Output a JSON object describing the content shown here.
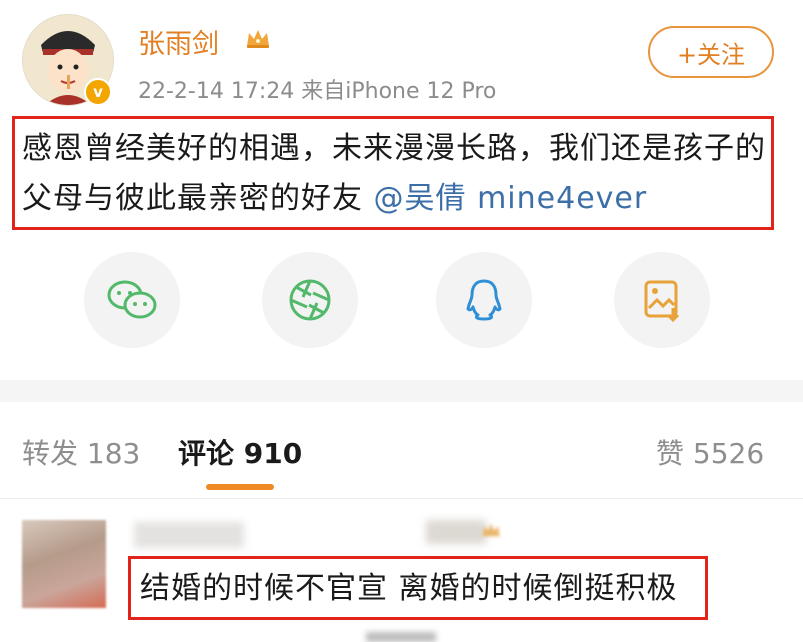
{
  "post": {
    "username": "张雨剑",
    "meta": "22-2-14 17:24 来自iPhone 12 Pro",
    "follow_label": "+关注",
    "verified_mark": "v",
    "text_main": "感恩曾经美好的相遇，未来漫漫长路，我们还是孩子的父母与彼此最亲密的好友",
    "mention": "@吴倩 mine4ever"
  },
  "share": {
    "icons": [
      "wechat-icon",
      "moments-icon",
      "qq-icon",
      "save-image-icon"
    ]
  },
  "tabs": {
    "repost": "转发 183",
    "comments": "评论 910",
    "likes": "赞 5526"
  },
  "comment": {
    "text": "结婚的时候不官宣 离婚的时候倒挺积极"
  },
  "colors": {
    "accent": "#e37f23",
    "highlight_box": "#e2231a",
    "mention": "#3c6fa8",
    "wechat": "#52b96b",
    "moments": "#52b96b",
    "qq": "#2e8fd6",
    "save": "#e8a23a"
  }
}
